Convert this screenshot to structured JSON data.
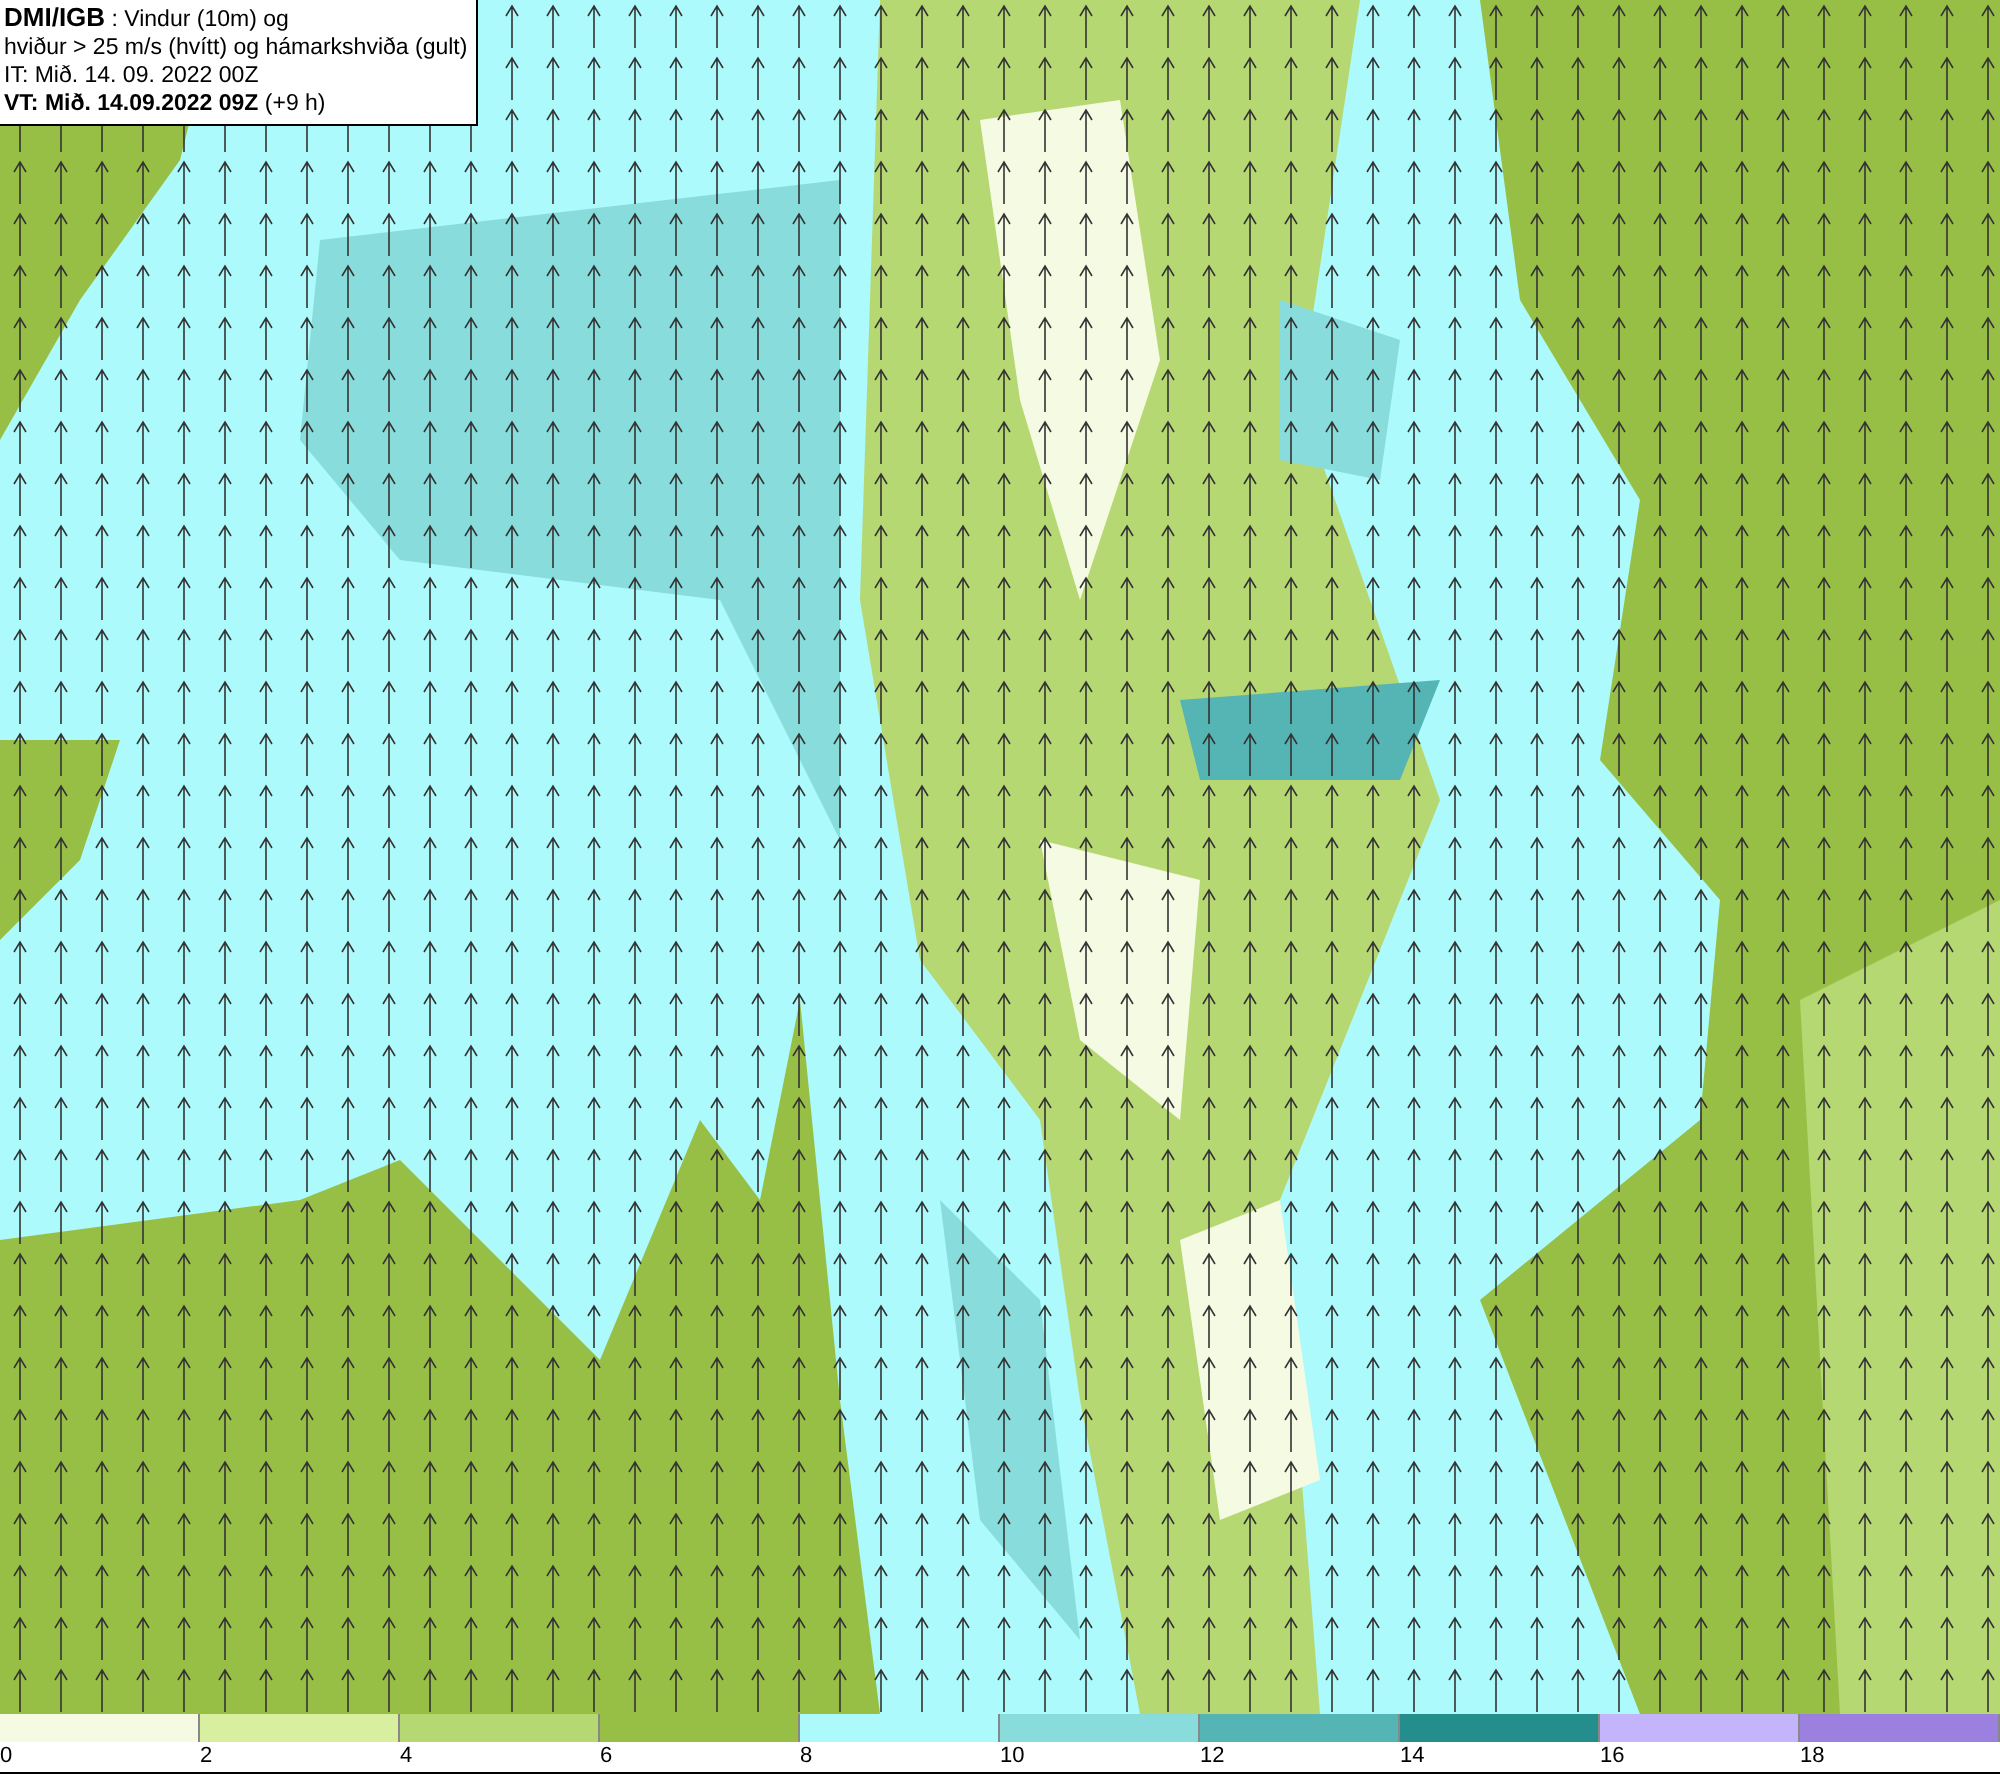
{
  "header": {
    "lines": [
      "**DMI/IGB** : Vindur (10m) og",
      "hviður > 25 m/s (hvítt) og hámarkshviða (gult)",
      "IT: Mið. 14. 09. 2022 00Z",
      "**VT: Mið. 14.09.2022 09Z** (+9 h)"
    ]
  },
  "legend": [
    {
      "label": "0",
      "color": "#f4fbe2"
    },
    {
      "label": "2",
      "color": "#d7ef9f"
    },
    {
      "label": "4",
      "color": "#b6d872"
    },
    {
      "label": "6",
      "color": "#98bf45"
    },
    {
      "label": "8",
      "color": "#acfafb"
    },
    {
      "label": "10",
      "color": "#88dcdc"
    },
    {
      "label": "12",
      "color": "#55b4b4"
    },
    {
      "label": "14",
      "color": "#238e8c"
    },
    {
      "label": "16",
      "color": "#c4b4fb"
    },
    {
      "label": "18",
      "color": "#9b80e0"
    }
  ]
}
